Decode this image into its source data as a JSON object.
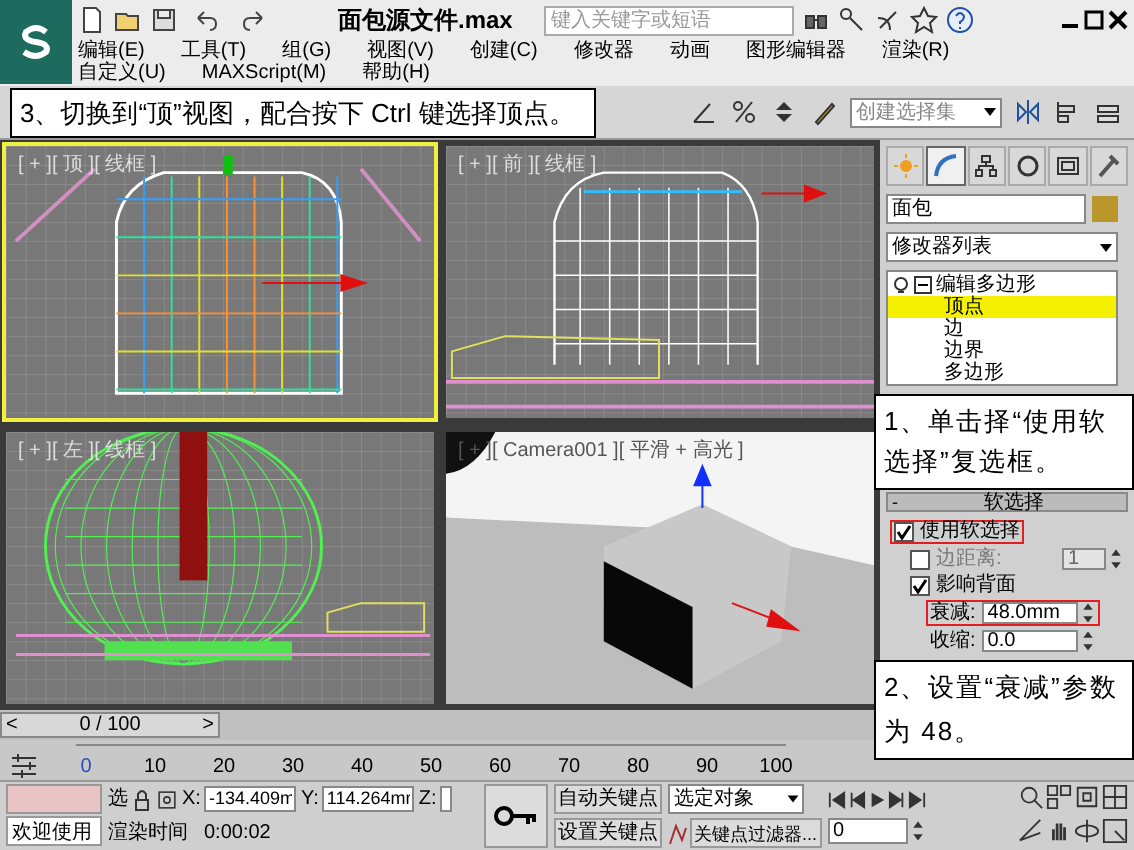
{
  "title_bar": {
    "title": "面包源文件.max",
    "search_placeholder": "键入关键字或短语"
  },
  "menu": [
    "编辑(E)",
    "工具(T)",
    "组(G)",
    "视图(V)",
    "创建(C)",
    "修改器",
    "动画",
    "图形编辑器",
    "渲染(R)",
    "自定义(U)",
    "MAXScript(M)",
    "帮助(H)"
  ],
  "toolbar": {
    "selection_set_placeholder": "创建选择集"
  },
  "callouts": [
    {
      "text": "3、切换到“顶”视图，配合按下 Ctrl 键选择顶点。"
    },
    {
      "text": "1、单击择“使用软选择”复选框。"
    },
    {
      "text": "2、设置“衰减”参数为 48。"
    }
  ],
  "viewports": [
    {
      "kind": "top",
      "label": "[ + ][ 顶 ][ 线框 ]",
      "selected": true
    },
    {
      "kind": "front",
      "label": "[ + ][ 前 ][ 线框 ]",
      "selected": false
    },
    {
      "kind": "left",
      "label": "[ + ][ 左 ][ 线框 ]",
      "selected": false
    },
    {
      "kind": "camera",
      "label": "[ + ][ Camera001 ][ 平滑 + 高光 ]",
      "selected": false
    }
  ],
  "command_panel": {
    "tabs": [
      {
        "kind": "create",
        "selected": false
      },
      {
        "kind": "modify",
        "selected": true
      },
      {
        "kind": "hierarchy",
        "selected": false
      },
      {
        "kind": "motion",
        "selected": false
      },
      {
        "kind": "display",
        "selected": false
      },
      {
        "kind": "utilities",
        "selected": false
      }
    ],
    "object_name": "面包",
    "modifier_list": "修改器列表",
    "stack": [
      {
        "label": "编辑多边形",
        "expanded": true,
        "children": [
          {
            "label": "顶点",
            "selected": true
          },
          {
            "label": "边",
            "selected": false
          },
          {
            "label": "边界",
            "selected": false
          },
          {
            "label": "多边形",
            "selected": false
          }
        ]
      }
    ],
    "rollout": {
      "title": "软选择",
      "sign": "-",
      "params": [
        {
          "kind": "checkbox",
          "label": "使用软选择",
          "checked": true,
          "highlighted": true
        },
        {
          "kind": "checkbox_spinner",
          "label": "边距离:",
          "checked": false,
          "value": "1",
          "disabled": true
        },
        {
          "kind": "checkbox",
          "label": "影响背面",
          "checked": true
        },
        {
          "kind": "spinner",
          "label": "衰减:",
          "value": "48.0mm",
          "highlighted": true
        },
        {
          "kind": "spinner",
          "label": "收缩:",
          "value": "0.0"
        }
      ]
    }
  },
  "time_slider": {
    "left": "<",
    "position": "0 / 100",
    "right": ">",
    "level": 0
  },
  "ruler": [
    "0",
    "10",
    "20",
    "30",
    "40",
    "50",
    "60",
    "70",
    "80",
    "90",
    "100"
  ],
  "status": {
    "welcome": "欢迎使用",
    "select_label": "选",
    "x_label": "X:",
    "x": "-134.409m",
    "y_label": "Y:",
    "y": "114.264mr",
    "z_label": "Z:",
    "render_time_label": "渲染时间",
    "render_time": "0:00:02",
    "auto_key": "自动关键点",
    "set_key": "设置关键点",
    "key_mode": "选定对象",
    "key_filters": "关键点过滤器...",
    "frame": "0"
  }
}
